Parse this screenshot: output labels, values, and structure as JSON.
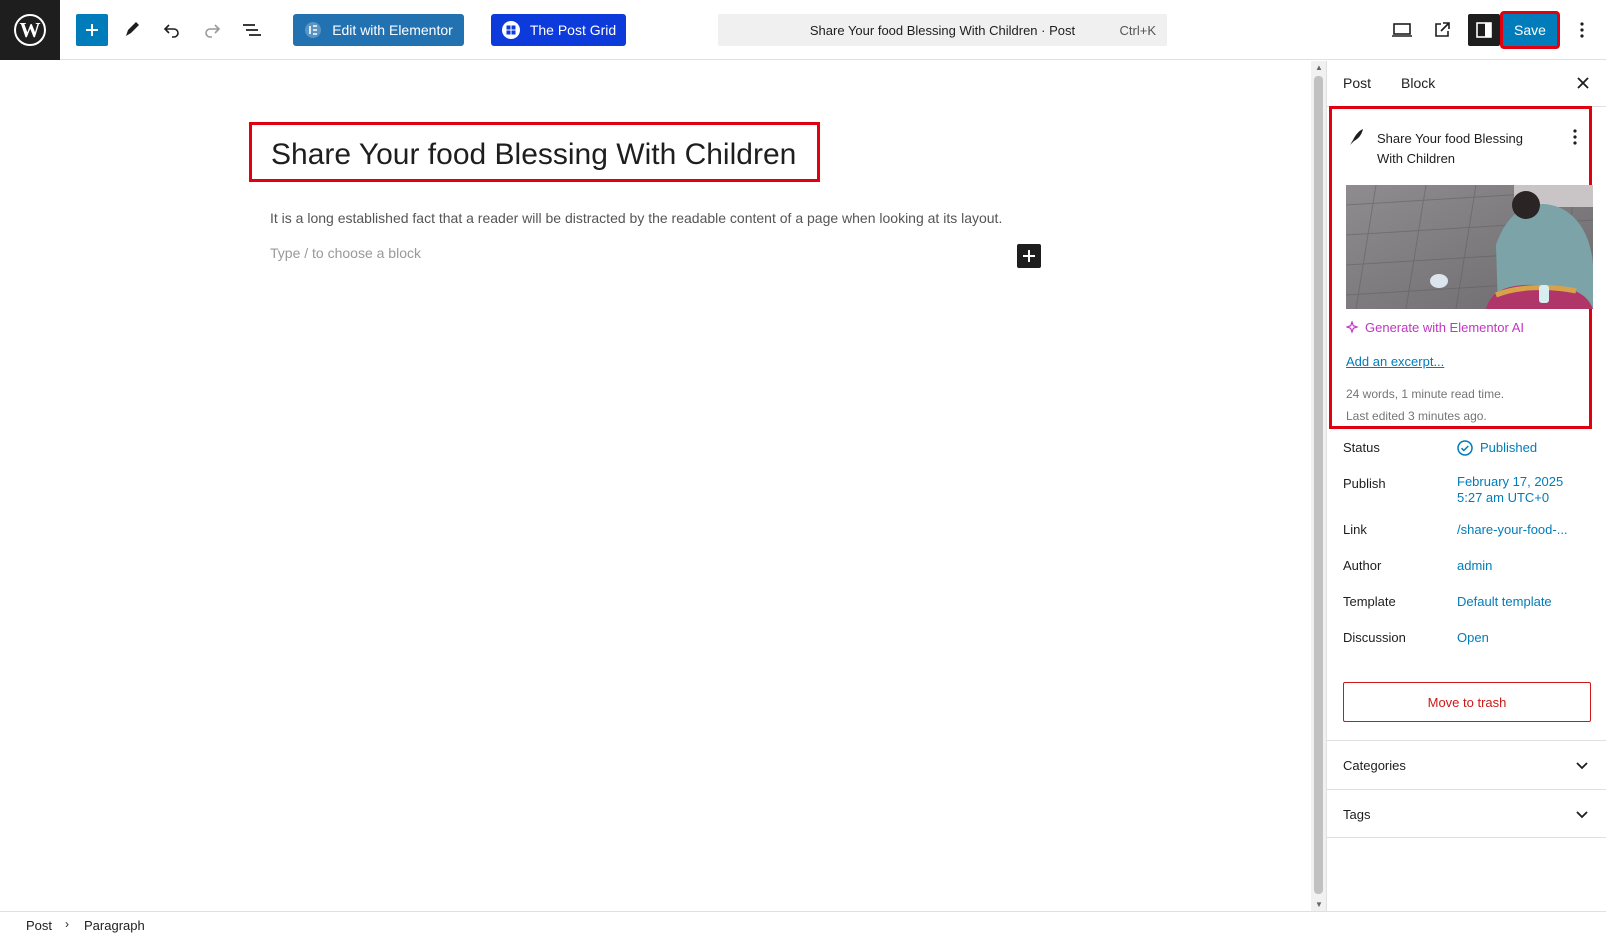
{
  "toolbar": {
    "elementor_label": "Edit with Elementor",
    "postgrid_label": "The Post Grid",
    "command_title": "Share Your food Blessing With Children · Post",
    "command_shortcut": "Ctrl+K",
    "save_label": "Save"
  },
  "editor": {
    "title": "Share Your food Blessing With Children",
    "paragraph": "It is a long established fact that a reader will be distracted by the readable content of a page when looking at its layout.",
    "placeholder": "Type / to choose a block"
  },
  "sidebar": {
    "tabs": [
      "Post",
      "Block"
    ],
    "summary": {
      "title": "Share Your food Blessing With Children",
      "generate_ai": "Generate with Elementor AI",
      "excerpt_link": "Add an excerpt...",
      "word_count": "24 words, 1 minute read time.",
      "last_edited": "Last edited 3 minutes ago."
    },
    "rows": {
      "status": {
        "label": "Status",
        "value": "Published"
      },
      "publish": {
        "label": "Publish",
        "value_line1": "February 17, 2025",
        "value_line2": "5:27 am UTC+0"
      },
      "link": {
        "label": "Link",
        "value": "/share-your-food-..."
      },
      "author": {
        "label": "Author",
        "value": "admin"
      },
      "template": {
        "label": "Template",
        "value": "Default template"
      },
      "discussion": {
        "label": "Discussion",
        "value": "Open"
      }
    },
    "trash_label": "Move to trash",
    "panels": [
      "Categories",
      "Tags"
    ]
  },
  "breadcrumb": [
    "Post",
    "Paragraph"
  ],
  "colors": {
    "accent": "#007cba",
    "highlight": "#e0000f",
    "elementor": "#2271b1",
    "postgrid": "#0d3bdb",
    "ai": "#c036c3",
    "danger": "#cc1818"
  }
}
